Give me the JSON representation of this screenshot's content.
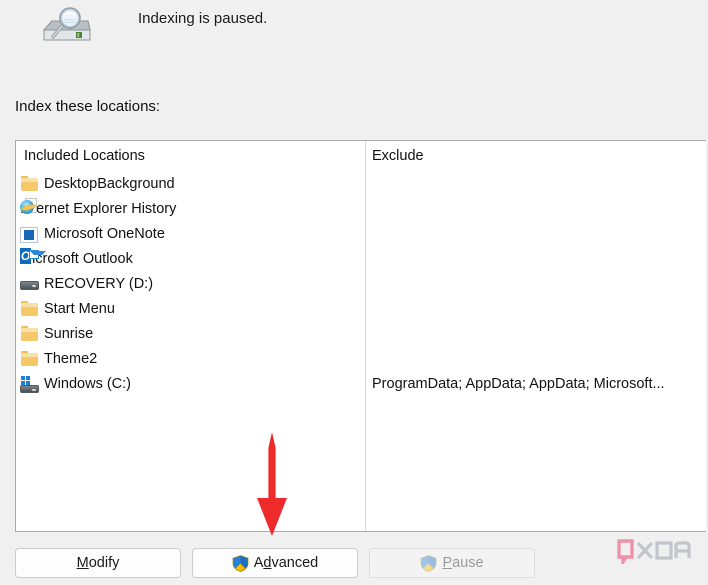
{
  "window": {
    "status_text": "Indexing is paused.",
    "status_icon": "drive-search-icon",
    "section_label": "Index these locations:"
  },
  "listview": {
    "columns": [
      {
        "key": "included",
        "header": "Included Locations"
      },
      {
        "key": "exclude",
        "header": "Exclude"
      }
    ],
    "rows": [
      {
        "icon": "folder-icon",
        "label": "DesktopBackground",
        "exclude": ""
      },
      {
        "icon": "internet-explorer-icon",
        "label": "Internet Explorer History",
        "exclude": ""
      },
      {
        "icon": "onenote-icon",
        "label": "Microsoft OneNote",
        "exclude": ""
      },
      {
        "icon": "outlook-icon",
        "label": "Microsoft Outlook",
        "exclude": ""
      },
      {
        "icon": "drive-icon",
        "label": "RECOVERY (D:)",
        "exclude": ""
      },
      {
        "icon": "folder-icon",
        "label": "Start Menu",
        "exclude": ""
      },
      {
        "icon": "folder-icon",
        "label": "Sunrise",
        "exclude": ""
      },
      {
        "icon": "folder-icon",
        "label": "Theme2",
        "exclude": ""
      },
      {
        "icon": "windows-drive-icon",
        "label": "Windows (C:)",
        "exclude": "ProgramData; AppData; AppData; Microsoft..."
      }
    ]
  },
  "buttons": {
    "modify": {
      "label_pre": "",
      "accel": "M",
      "label_post": "odify",
      "enabled": true,
      "has_shield": false
    },
    "advanced": {
      "label_pre": "A",
      "accel": "d",
      "label_post": "vanced",
      "enabled": true,
      "has_shield": true
    },
    "pause": {
      "label_pre": "",
      "accel": "P",
      "label_post": "ause",
      "enabled": false,
      "has_shield": true
    }
  },
  "annotation": {
    "arrow": "red-down-arrow",
    "arrow_color": "#ee2b2b",
    "points_at": "advanced-button"
  },
  "watermark": {
    "text": "XDA",
    "mark_color": "#f07d9a"
  },
  "colors": {
    "background": "#f0f0f0",
    "listview_background": "#ffffff",
    "listview_border": "#a9a9a9",
    "text": "#111111",
    "disabled_text": "#9a9a9a",
    "accent_red": "#ee2b2b"
  }
}
